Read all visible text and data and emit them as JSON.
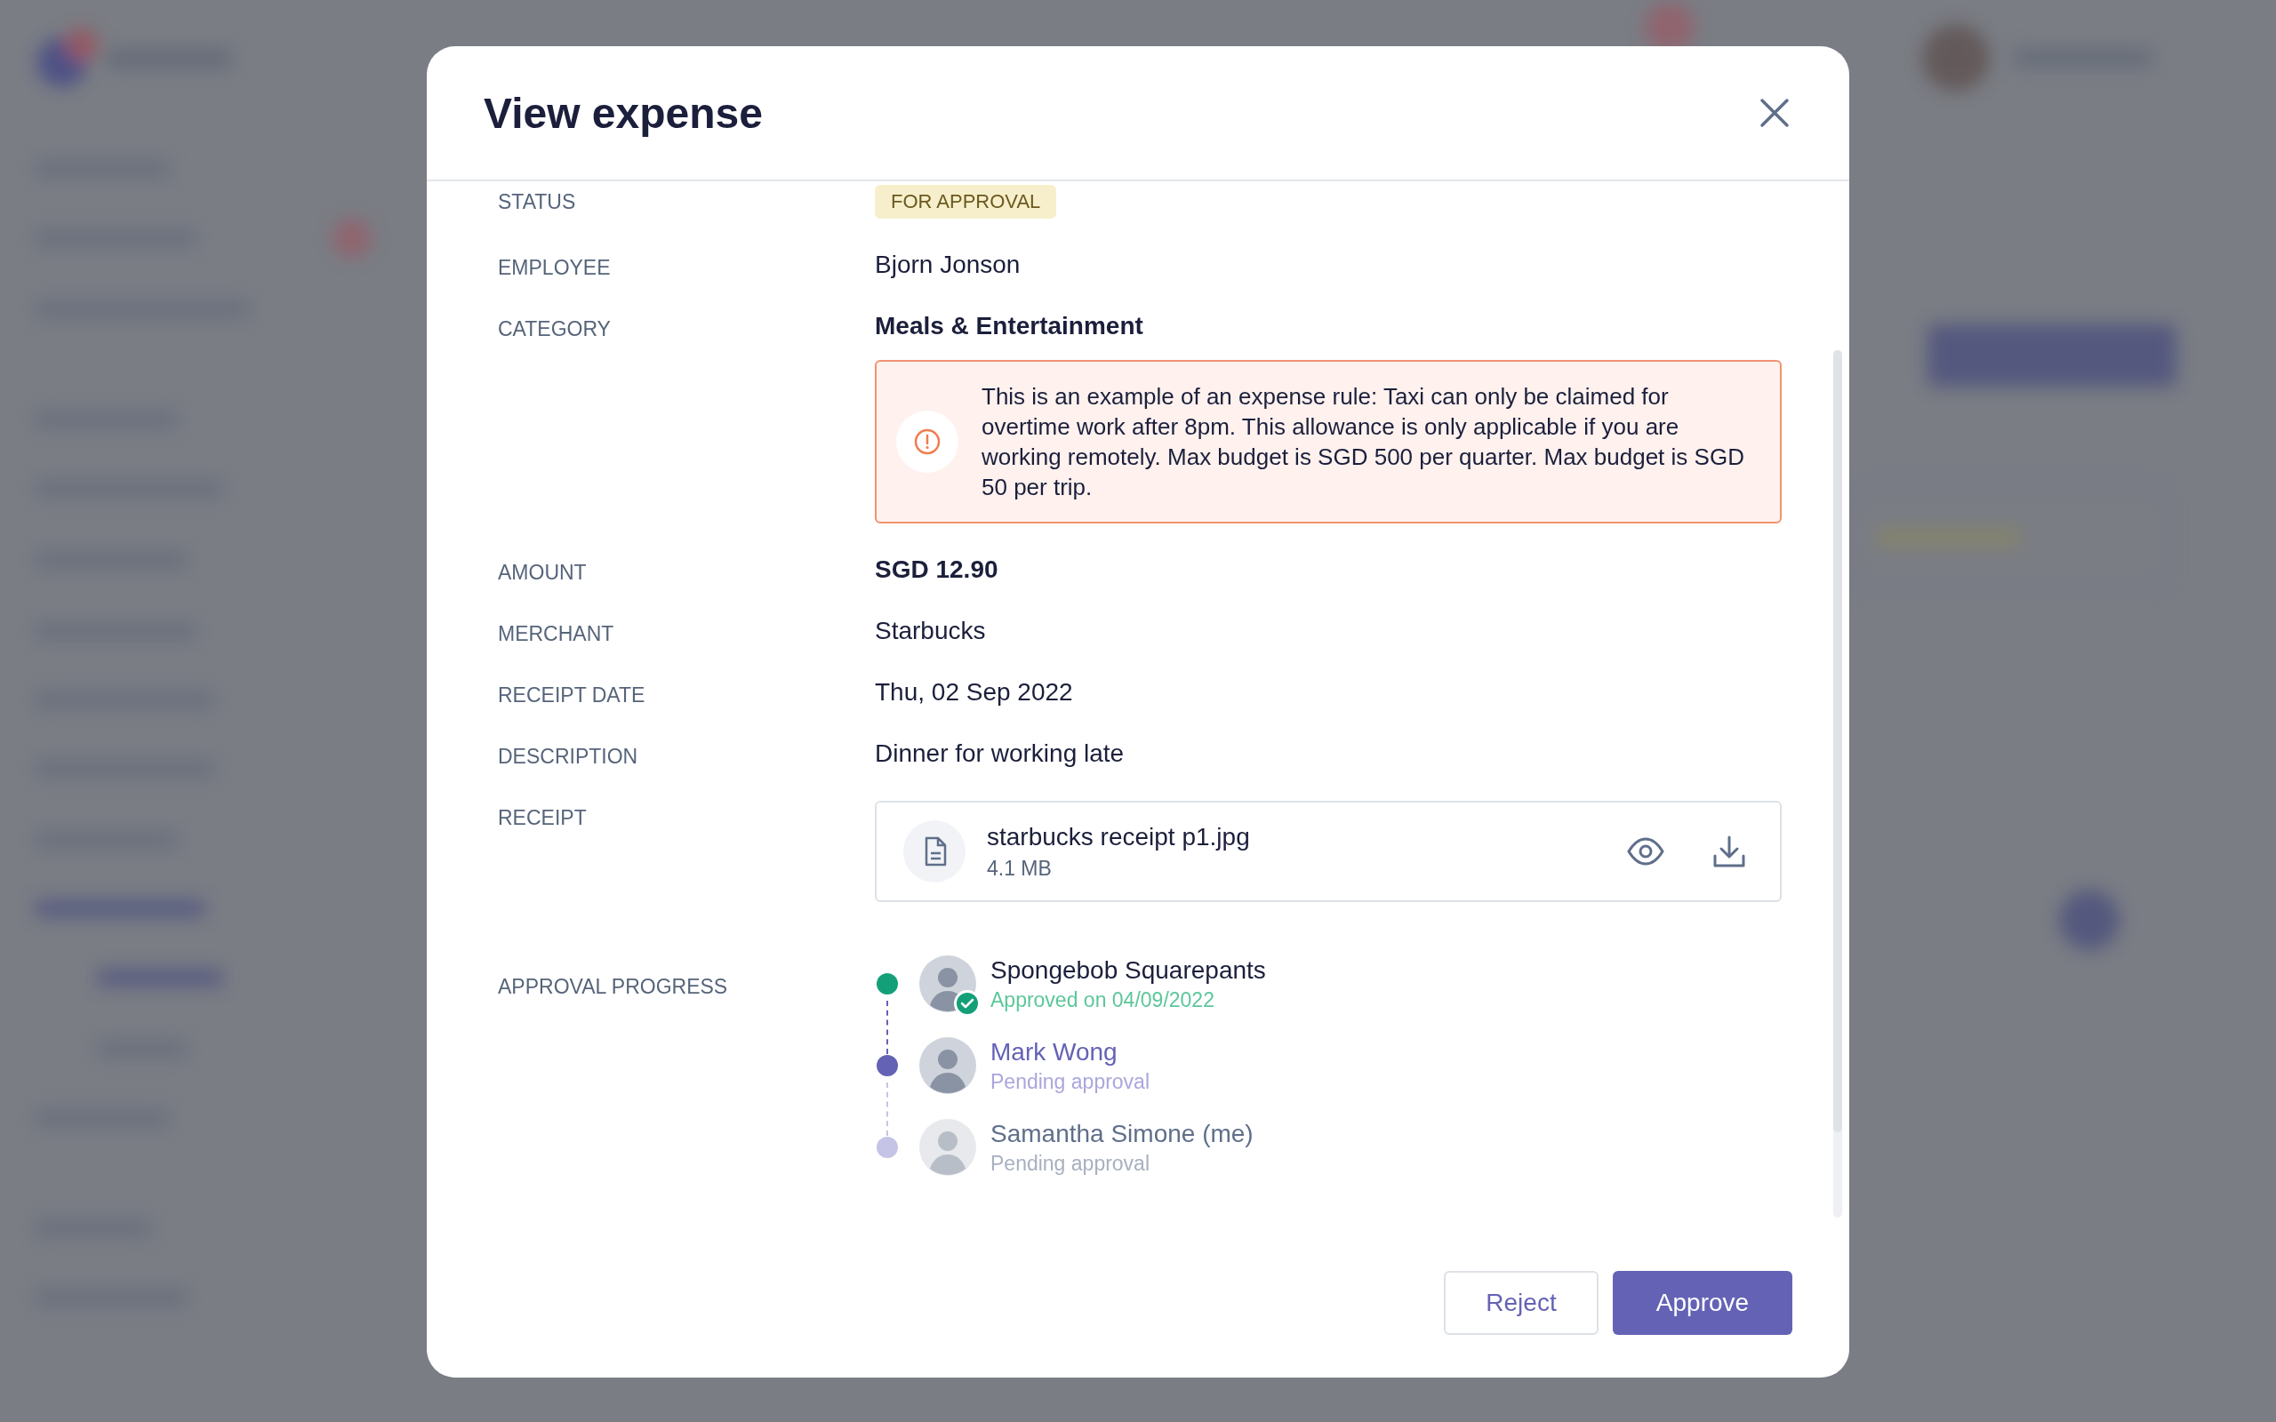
{
  "window": {
    "title": "View expense"
  },
  "fields": [
    {
      "label": "STATUS",
      "kind": "badge",
      "value": "FOR APPROVAL"
    },
    {
      "label": "EMPLOYEE",
      "kind": "text",
      "value": "Bjorn Jonson"
    },
    {
      "label": "CATEGORY",
      "kind": "strong",
      "value": "Meals & Entertainment",
      "alert": "This is an example of an expense rule: Taxi can only be claimed for overtime work after 8pm. This allowance is only applicable if you are working remotely. Max budget is SGD 500 per quarter. Max budget is SGD 50 per trip."
    },
    {
      "label": "AMOUNT",
      "kind": "strong",
      "value": "SGD 12.90"
    },
    {
      "label": "MERCHANT",
      "kind": "text",
      "value": "Starbucks"
    },
    {
      "label": "RECEIPT DATE",
      "kind": "text",
      "value": "Thu, 02 Sep 2022"
    },
    {
      "label": "DESCRIPTION",
      "kind": "text",
      "value": "Dinner for working late"
    },
    {
      "label": "RECEIPT",
      "kind": "file",
      "file_name": "starbucks receipt p1.jpg",
      "file_size": "4.1 MB"
    }
  ],
  "approval_progress": {
    "label": "APPROVAL PROGRESS",
    "steps": [
      {
        "name": "Spongebob Squarepants",
        "note": "Approved on 04/09/2022",
        "kind": "approved"
      },
      {
        "name": "Mark Wong",
        "note": "Pending approval",
        "kind": "current"
      },
      {
        "name": "Samantha Simone (me)",
        "note": "Pending approval",
        "kind": "pending"
      }
    ]
  },
  "buttons": [
    {
      "label": "Reject",
      "kind": "secondary"
    },
    {
      "label": "Approve",
      "kind": "primary"
    }
  ]
}
